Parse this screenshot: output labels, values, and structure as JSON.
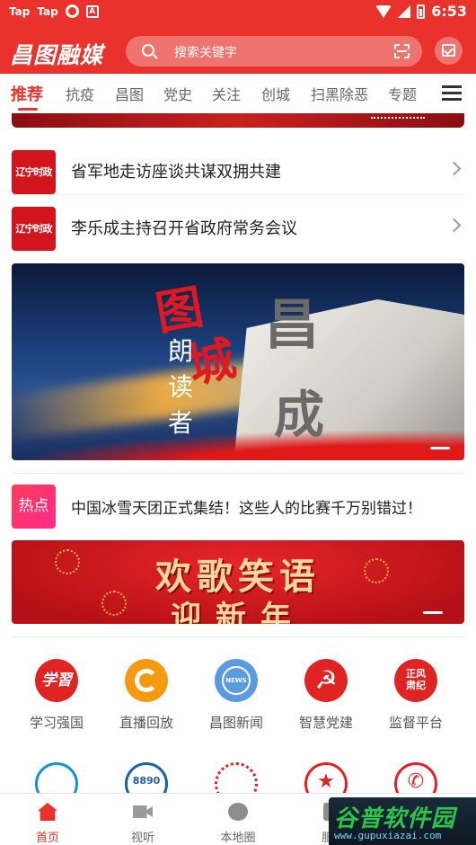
{
  "status_bar": {
    "left_icons": [
      "Tap",
      "Tap",
      "app-icon",
      "A"
    ],
    "time": "6:53"
  },
  "app_bar": {
    "logo": "昌图融媒",
    "search_placeholder": "搜索关键字",
    "accent_color": "#e8322b"
  },
  "tabs": [
    {
      "label": "推荐",
      "active": true
    },
    {
      "label": "抗疫",
      "active": false
    },
    {
      "label": "昌图",
      "active": false
    },
    {
      "label": "党史",
      "active": false
    },
    {
      "label": "关注",
      "active": false
    },
    {
      "label": "创城",
      "active": false
    },
    {
      "label": "扫黑除恶",
      "active": false
    },
    {
      "label": "专题",
      "active": false
    }
  ],
  "news": [
    {
      "thumb": "辽宁时政",
      "title": "省军地走访座谈共谋双拥共建"
    },
    {
      "thumb": "辽宁时政",
      "title": "李乐成主持召开省政府常务会议"
    }
  ],
  "feature_banner": {
    "glyphs": [
      "图",
      "城",
      "昌",
      "成"
    ],
    "vertical_text": "朗读者"
  },
  "hot_item": {
    "badge": "热点",
    "title": "中国冰雪天团正式集结！这些人的比赛千万别错过！"
  },
  "festival_banner": {
    "line1": "欢歌笑语",
    "line2": "迎新年"
  },
  "quick_grid": [
    {
      "label": "学习强国",
      "icon": "xuexi-icon",
      "glyph": "学習",
      "color": "#e02424"
    },
    {
      "label": "直播回放",
      "icon": "live-replay-icon",
      "glyph": "",
      "color": "#f59a10"
    },
    {
      "label": "昌图新闻",
      "icon": "news-globe-icon",
      "glyph": "NEWS",
      "color": "#5a9ae0"
    },
    {
      "label": "智慧党建",
      "icon": "party-emblem-icon",
      "glyph": "☭",
      "color": "#e02424"
    },
    {
      "label": "监督平台",
      "icon": "supervision-icon",
      "glyph": "正风肃纪",
      "color": "#e02424"
    }
  ],
  "quick_grid_row2": [
    {
      "icon": "home-service-icon",
      "glyph": "",
      "color": "#1d8fd8"
    },
    {
      "icon": "hotline-8890-icon",
      "glyph": "8890",
      "color": "#1f5fa8"
    },
    {
      "icon": "emblem-icon",
      "glyph": "",
      "color": "#e02424"
    },
    {
      "icon": "star-icon",
      "glyph": "★",
      "color": "#e02424"
    },
    {
      "icon": "phone-icon",
      "glyph": "✆",
      "color": "#e02424"
    }
  ],
  "bottom_nav": [
    {
      "label": "首页",
      "icon": "home-icon",
      "active": true
    },
    {
      "label": "视听",
      "icon": "video-icon",
      "active": false
    },
    {
      "label": "本地圈",
      "icon": "planet-icon",
      "active": false
    },
    {
      "label": "服务",
      "icon": "service-icon",
      "active": false
    }
  ],
  "watermark": {
    "main": "谷普软件园",
    "url": "www.gupuxiazai.com"
  }
}
